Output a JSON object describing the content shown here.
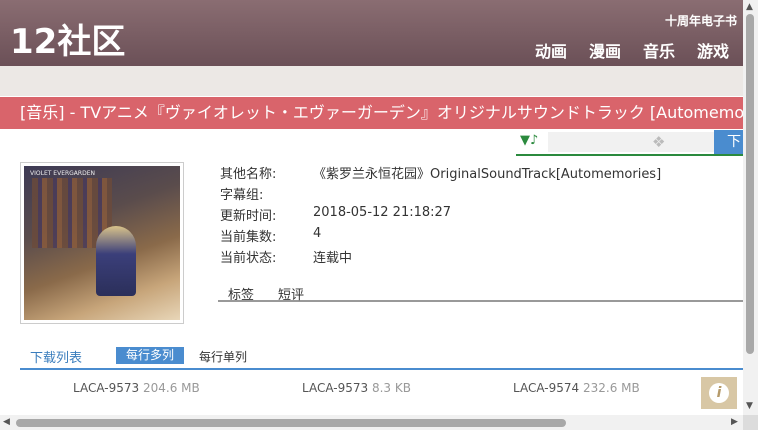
{
  "header": {
    "logo": "12社区",
    "tagline": "十周年电子书",
    "nav": [
      "动画",
      "漫画",
      "音乐",
      "游戏"
    ]
  },
  "title": "[音乐] - TVアニメ『ヴァイオレット・エヴァーガーデン』オリジナルサウンドトラック [Automemories]",
  "player": {
    "music_icon": "▼♪",
    "puzzle_icon": "puzzle-icon"
  },
  "download_button_label": "下载",
  "cover": {
    "label": "VIOLET EVERGARDEN"
  },
  "info": [
    {
      "key": "其他名称:",
      "value": "《紫罗兰永恒花园》OriginalSoundTrack[Automemories]"
    },
    {
      "key": "字幕组:",
      "value": ""
    },
    {
      "key": "更新时间:",
      "value": "2018-05-12 21:18:27"
    },
    {
      "key": "当前集数:",
      "value": "4"
    },
    {
      "key": "当前状态:",
      "value": "连载中"
    }
  ],
  "tabs": [
    "标签",
    "短评"
  ],
  "download_list": {
    "label": "下载列表",
    "multi_label": "每行多列",
    "single_label": "每行单列",
    "files": [
      {
        "name": "LACA-9573",
        "size": "204.6 MB"
      },
      {
        "name": "LACA-9573",
        "size": "8.3 KB"
      },
      {
        "name": "LACA-9574",
        "size": "232.6 MB"
      }
    ]
  },
  "float_info_icon": "i",
  "colors": {
    "header": "#7a5e64",
    "title_bar": "#d9646b",
    "accent_blue": "#4a8ccf",
    "accent_green": "#2b8a3e"
  }
}
